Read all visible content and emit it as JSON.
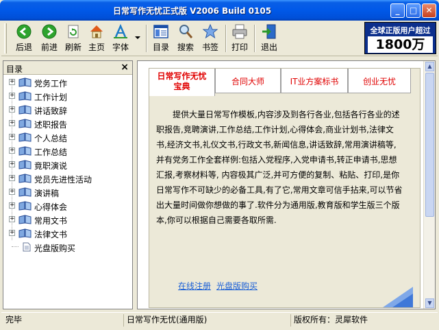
{
  "window": {
    "title": "日常写作无忧正式版 V2006 Build 0105",
    "titlebar_color": "#0058E8"
  },
  "toolbar": {
    "buttons": [
      {
        "label": "后退",
        "icon": "back-arrow-icon"
      },
      {
        "label": "前进",
        "icon": "forward-arrow-icon"
      },
      {
        "label": "刷新",
        "icon": "refresh-icon"
      },
      {
        "label": "主页",
        "icon": "home-icon"
      },
      {
        "label": "字体",
        "icon": "font-icon"
      },
      {
        "label": "目录",
        "icon": "toc-icon"
      },
      {
        "label": "搜索",
        "icon": "search-icon"
      },
      {
        "label": "书签",
        "icon": "bookmark-star-icon"
      },
      {
        "label": "打印",
        "icon": "printer-icon"
      },
      {
        "label": "退出",
        "icon": "exit-icon"
      }
    ],
    "ad": {
      "line1": "全球正版用户超过",
      "line2": "1800万"
    }
  },
  "sidebar": {
    "title": "目录",
    "close": "×",
    "items": [
      {
        "label": "党务工作",
        "expand": "+"
      },
      {
        "label": "工作计划",
        "expand": "+"
      },
      {
        "label": "讲话致辞",
        "expand": "+"
      },
      {
        "label": "述职报告",
        "expand": "+"
      },
      {
        "label": "个人总结",
        "expand": "+"
      },
      {
        "label": "工作总结",
        "expand": "+"
      },
      {
        "label": "竟职演说",
        "expand": "+"
      },
      {
        "label": "党员先进性活动",
        "expand": "+"
      },
      {
        "label": "演讲稿",
        "expand": "+"
      },
      {
        "label": "心得体会",
        "expand": "+"
      },
      {
        "label": "常用文书",
        "expand": "+"
      },
      {
        "label": "法律文书",
        "expand": "+"
      },
      {
        "label": "光盘版购买",
        "expand": ""
      }
    ]
  },
  "content": {
    "tabs": [
      {
        "label_line1": "日常写作无忧",
        "label_line2": "宝典"
      },
      {
        "label": "合同大师"
      },
      {
        "label": "IT业方案标书"
      },
      {
        "label": "创业无忧"
      }
    ],
    "body_text": "提供大量日常写作模板,内容涉及到各行各业,包括各行各业的述职报告,竞聘演讲,工作总结,工作计划,心得体会,商业计划书,法律文书,经济文书,礼仪文书,行政文书,新闻信息,讲话致辞,常用演讲稿等,并有党务工作全套样例:包括入党程序,入党申请书,转正申请书,思想汇报,考察材料等, 内容极其广泛,并可方便的复制、粘贴、打印,是你日常写作不可缺少的必备工具,有了它,常用文章可信手拈来,可以节省出大量时间做你想做的事了.软件分为通用版,教育版和学生版三个版本,你可以根据自己需要各取所需.",
    "links": [
      "在线注册",
      "光盘版购买"
    ],
    "tab_text_color": "#E00000",
    "link_color": "#1A5FD6"
  },
  "status": {
    "left": "完毕",
    "middle": "日常写作无忧(通用版)",
    "right": "版权所有：灵犀软件"
  }
}
